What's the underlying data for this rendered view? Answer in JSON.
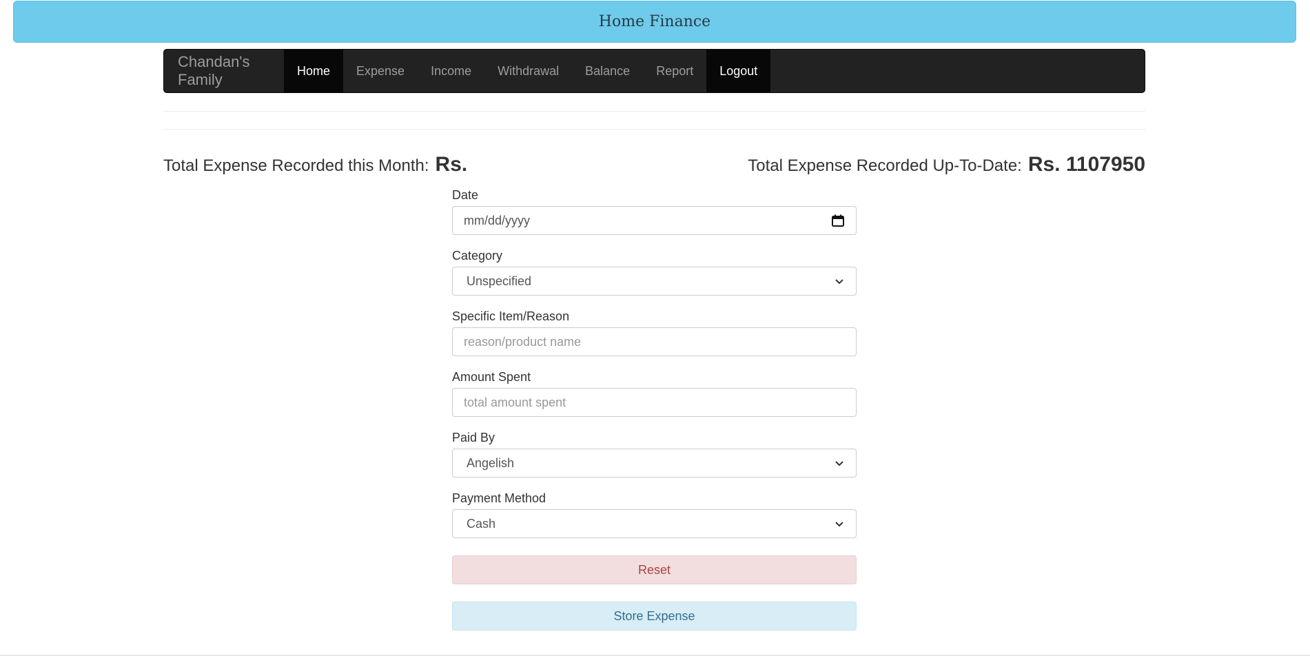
{
  "header": {
    "title": "Home Finance"
  },
  "navbar": {
    "brand": "Chandan's Family",
    "items": [
      {
        "label": "Home",
        "active": true
      },
      {
        "label": "Expense",
        "active": false
      },
      {
        "label": "Income",
        "active": false
      },
      {
        "label": "Withdrawal",
        "active": false
      },
      {
        "label": "Balance",
        "active": false
      },
      {
        "label": "Report",
        "active": false
      },
      {
        "label": "Logout",
        "active": true
      }
    ]
  },
  "stats": {
    "month_label": "Total Expense Recorded this Month:",
    "month_value": "Rs.",
    "total_label": "Total Expense Recorded Up-To-Date:",
    "total_value": "Rs. 1107950"
  },
  "form": {
    "date": {
      "label": "Date",
      "placeholder": "mm/dd/yyyy"
    },
    "category": {
      "label": "Category",
      "selected": "Unspecified"
    },
    "item": {
      "label": "Specific Item/Reason",
      "placeholder": "reason/product name"
    },
    "amount": {
      "label": "Amount Spent",
      "placeholder": "total amount spent"
    },
    "paid_by": {
      "label": "Paid By",
      "selected": "Angelish"
    },
    "payment_method": {
      "label": "Payment Method",
      "selected": "Cash"
    },
    "reset_label": "Reset",
    "store_label": "Store Expense"
  },
  "colors": {
    "banner": "#6ecbec",
    "navbar": "#222222",
    "reset_bg": "#f2dede",
    "store_bg": "#d9edf7"
  }
}
